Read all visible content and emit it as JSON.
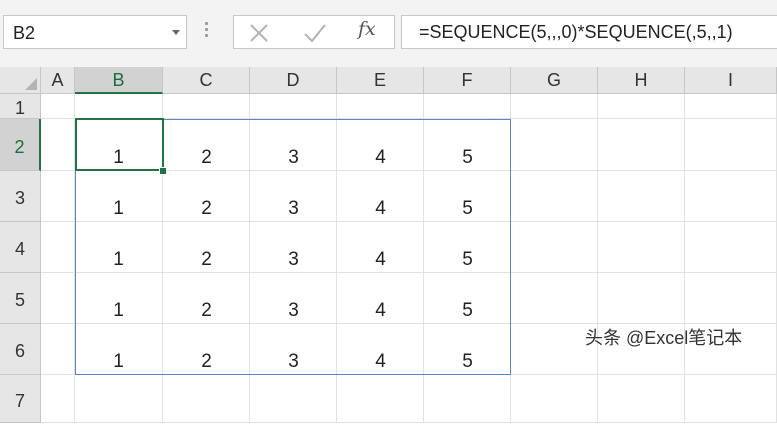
{
  "name_box": {
    "value": "B2"
  },
  "formula_bar": {
    "fx_label": "fx",
    "formula": "=SEQUENCE(5,,,0)*SEQUENCE(,5,,1)"
  },
  "columns": [
    "A",
    "B",
    "C",
    "D",
    "E",
    "F",
    "G",
    "H",
    "I"
  ],
  "rows": [
    "1",
    "2",
    "3",
    "4",
    "5",
    "6",
    "7"
  ],
  "active": {
    "column": "B",
    "row": "2"
  },
  "cells": [
    [
      "1",
      "2",
      "3",
      "4",
      "5"
    ],
    [
      "1",
      "2",
      "3",
      "4",
      "5"
    ],
    [
      "1",
      "2",
      "3",
      "4",
      "5"
    ],
    [
      "1",
      "2",
      "3",
      "4",
      "5"
    ],
    [
      "1",
      "2",
      "3",
      "4",
      "5"
    ]
  ],
  "watermark": "头条 @Excel笔记本",
  "colors": {
    "accent": "#217346",
    "spill_border": "#5b87c5"
  }
}
